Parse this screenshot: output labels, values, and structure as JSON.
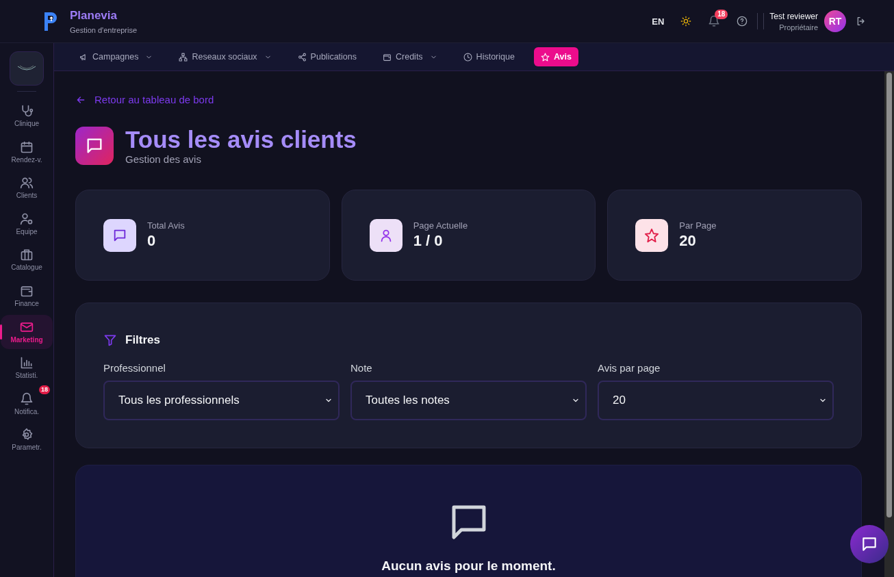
{
  "app": {
    "name": "Planevia",
    "subtitle": "Gestion d'entreprise"
  },
  "header": {
    "language": "EN",
    "notification_count": "18",
    "user_name": "Test reviewer",
    "user_role": "Propriétaire",
    "avatar_initials": "RT"
  },
  "sidebar": {
    "items": [
      {
        "label": "Clinique",
        "selected": false
      },
      {
        "label": "Rendez-v.",
        "selected": false
      },
      {
        "label": "Clients",
        "selected": false
      },
      {
        "label": "Equipe",
        "selected": false
      },
      {
        "label": "Catalogue",
        "selected": false
      },
      {
        "label": "Finance",
        "selected": false
      },
      {
        "label": "Marketing",
        "selected": true
      },
      {
        "label": "Statisti.",
        "selected": false
      },
      {
        "label": "Notifica.",
        "selected": false,
        "badge": "18"
      },
      {
        "label": "Parametr.",
        "selected": false
      }
    ]
  },
  "tabs": [
    {
      "label": "Campagnes",
      "selected": false,
      "dropdown": true
    },
    {
      "label": "Reseaux sociaux",
      "selected": false,
      "dropdown": true
    },
    {
      "label": "Publications",
      "selected": false,
      "dropdown": false
    },
    {
      "label": "Credits",
      "selected": false,
      "dropdown": true
    },
    {
      "label": "Historique",
      "selected": false,
      "dropdown": false
    },
    {
      "label": "Avis",
      "selected": true,
      "dropdown": false
    }
  ],
  "back_link": "Retour au tableau de bord",
  "page": {
    "title": "Tous les avis clients",
    "subtitle": "Gestion des avis"
  },
  "stats": [
    {
      "label": "Total Avis",
      "value": "0"
    },
    {
      "label": "Page Actuelle",
      "value": "1 / 0"
    },
    {
      "label": "Par Page",
      "value": "20"
    }
  ],
  "filters": {
    "title": "Filtres",
    "fields": [
      {
        "label": "Professionnel",
        "value": "Tous les professionnels"
      },
      {
        "label": "Note",
        "value": "Toutes les notes"
      },
      {
        "label": "Avis par page",
        "value": "20"
      }
    ]
  },
  "empty_state": {
    "message": "Aucun avis pour le moment."
  }
}
